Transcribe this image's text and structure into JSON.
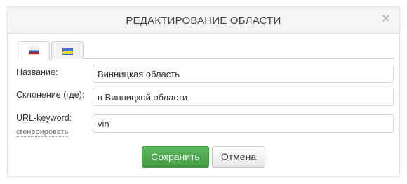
{
  "dialog": {
    "title": "РЕДАКТИРОВАНИЕ ОБЛАСТИ",
    "close": "×"
  },
  "tabs": [
    {
      "lang": "ru",
      "icon": "flag-ru-icon",
      "active": true
    },
    {
      "lang": "ua",
      "icon": "flag-ua-icon",
      "active": false
    }
  ],
  "form": {
    "name_label": "Название:",
    "name_value": "Винницкая область",
    "declension_label": "Склонение (где):",
    "declension_value": "в Винницкой области",
    "url_label": "URL-keyword:",
    "generate_link": "сгенерировать",
    "url_value": "vin"
  },
  "buttons": {
    "save": "Сохранить",
    "cancel": "Отмена"
  },
  "colors": {
    "save_bg": "#5cb85c",
    "header_bg": "#f5f5f5"
  }
}
